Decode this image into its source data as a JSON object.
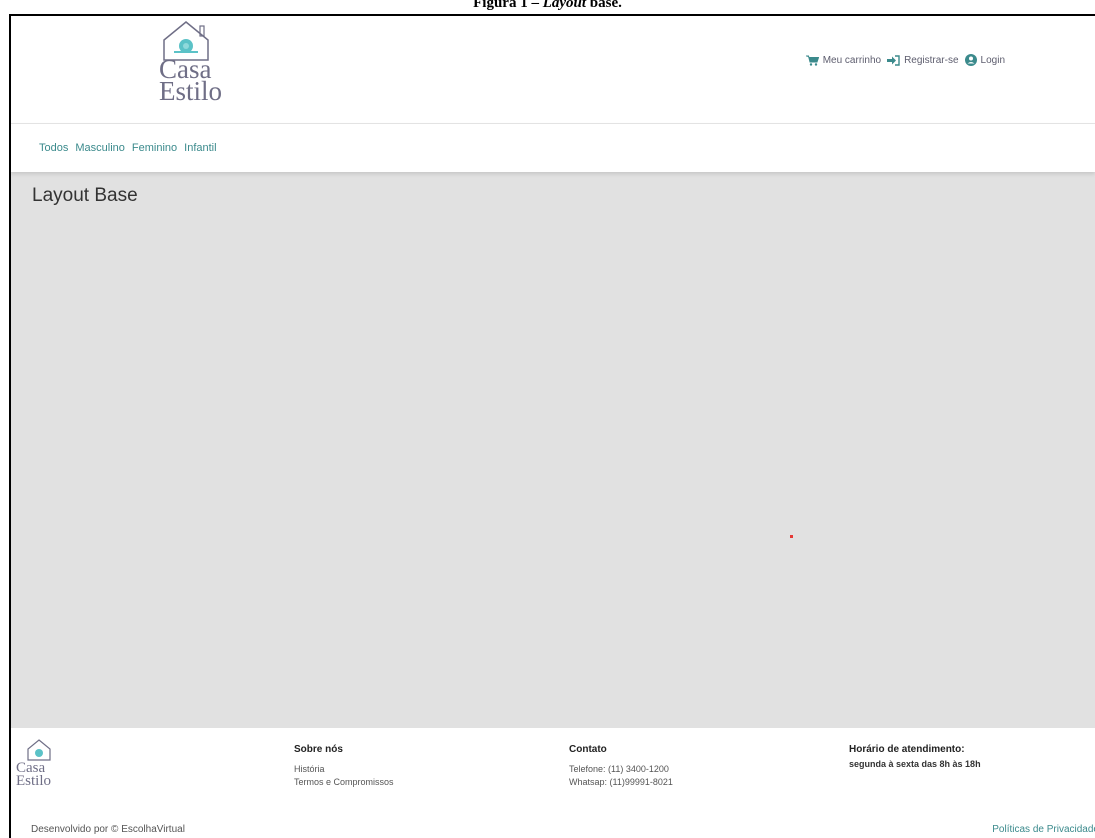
{
  "caption": {
    "prefix": "Figura 1 – ",
    "italic": "Layout",
    "suffix": " base."
  },
  "brand": {
    "line1": "Casa",
    "line2": "Estilo"
  },
  "header": {
    "cart_label": "Meu carrinho",
    "register_label": "Registrar-se",
    "login_label": "Login"
  },
  "categories": [
    "Todos",
    "Masculino",
    "Feminino",
    "Infantil"
  ],
  "main": {
    "title": "Layout Base"
  },
  "footer": {
    "about": {
      "title": "Sobre nós",
      "links": [
        "História",
        "Termos e Compromissos"
      ]
    },
    "contact": {
      "title": "Contato",
      "phone": "Telefone: (11) 3400-1200",
      "whatsapp": "Whatsap: (11)99991-8021"
    },
    "hours": {
      "title": "Horário de atendimento:",
      "text": "segunda à sexta das 8h às 18h"
    },
    "developed_by": "Desenvolvido por © EscolhaVirtual",
    "privacy": "Políticas de Privacidade"
  },
  "colors": {
    "accent": "#3b8a8c",
    "logo_text": "#6f6e86",
    "main_bg": "#e1e1e1",
    "dot": "#e53935"
  }
}
